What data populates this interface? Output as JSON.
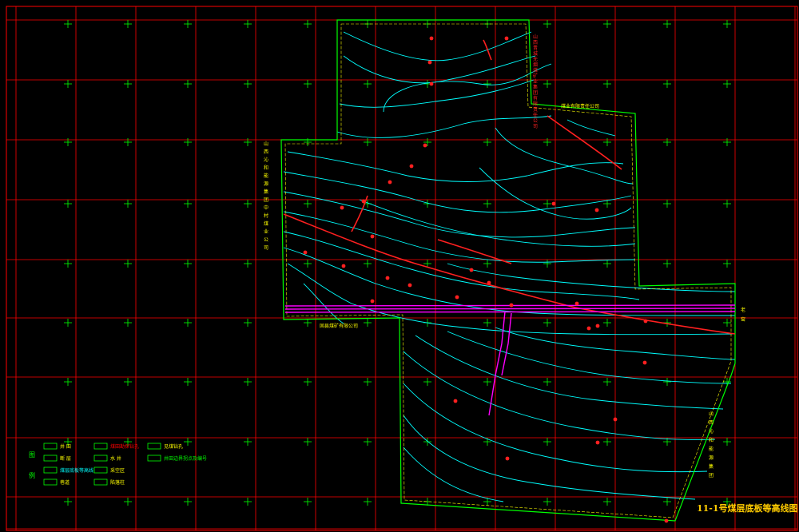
{
  "drawing": {
    "title": "11-1号煤层底板等高线图",
    "legend": {
      "heading_chars": [
        "图",
        "例"
      ],
      "items": [
        {
          "label": "井 田",
          "color": "#ffff00"
        },
        {
          "label": "断 层",
          "color": "#ffff00"
        },
        {
          "label": "煤层底板等高线",
          "color": "#00ffff"
        },
        {
          "label": "巷道",
          "color": "#ffff00"
        },
        {
          "label": "煤田勘探钻孔",
          "color": "#ff0000"
        },
        {
          "label": "水 井",
          "color": "#ffff00"
        },
        {
          "label": "采空区",
          "color": "#ffff00"
        },
        {
          "label": "陷落柱",
          "color": "#ffff00"
        },
        {
          "label": "见煤钻孔",
          "color": "#ffff00"
        },
        {
          "label": "井田边界拐点及编号",
          "color": "#00ff00"
        }
      ]
    },
    "boundary_labels": {
      "top_right_vertical": "山西晋城无烟煤矿业集团有限责任公司",
      "right_company": "煤业有限责任公司",
      "left_vertical": "山西沁和能源集团中村煤业公司",
      "bottom_left": "固县煤矿有限公司",
      "right_side_vertical": "老窑",
      "right_lower_vertical": "山西沁和能源集团"
    },
    "colors": {
      "grid": "#ff0000",
      "cross": "#00ff00",
      "contour": "#00ffff",
      "fault": "#ff2020",
      "roadway": "#ff00ff",
      "boundary": "#00ff00",
      "boundary_inner": "#ffff00",
      "title": "#ffcc00",
      "note": "#ff00ff"
    }
  }
}
